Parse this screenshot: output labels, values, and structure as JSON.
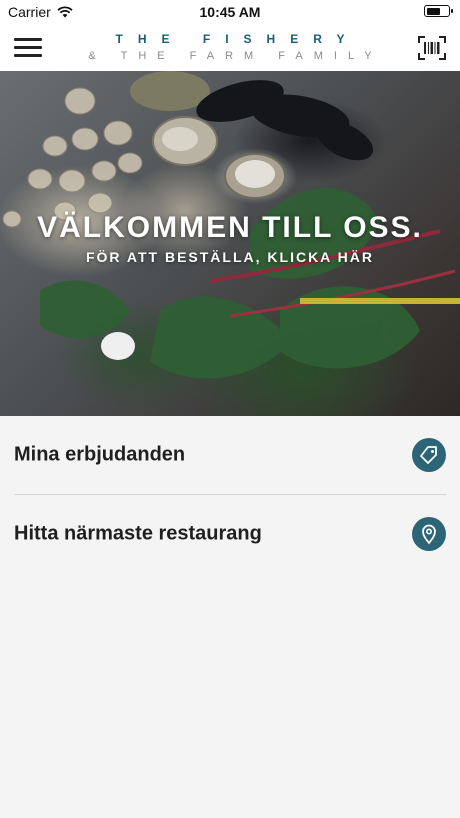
{
  "status_bar": {
    "carrier": "Carrier",
    "time": "10:45 AM",
    "battery_level": 0.7
  },
  "header": {
    "brand_line1": "THE FISHERY",
    "brand_line2": "& THE FARM FAMILY",
    "menu_icon": "hamburger-icon",
    "barcode_icon": "barcode-scan-icon",
    "brand_color": "#1a5f78"
  },
  "hero": {
    "title": "VÄLKOMMEN TILL OSS.",
    "subtitle": "FÖR ATT BESTÄLLA, KLICKA HÄR"
  },
  "menu": {
    "items": [
      {
        "label": "Mina erbjudanden",
        "icon": "tag-icon"
      },
      {
        "label": "Hitta närmaste restaurang",
        "icon": "location-pin-icon"
      }
    ],
    "icon_bg_color": "#2b6577"
  }
}
